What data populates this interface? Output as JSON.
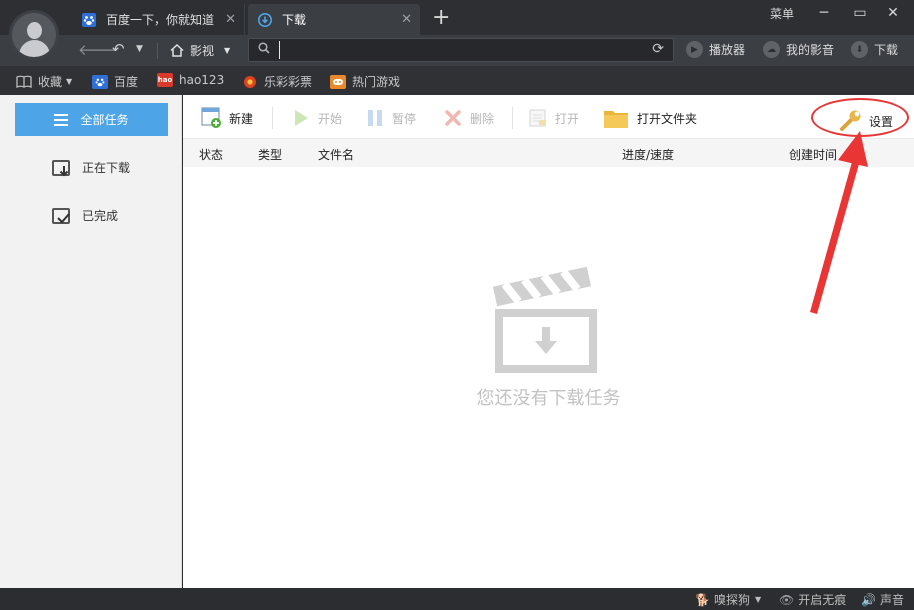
{
  "tabs": [
    {
      "title": "百度一下，你就知道",
      "icon": "baidu-paw-icon"
    },
    {
      "title": "下载",
      "icon": "download-icon"
    }
  ],
  "window": {
    "menu_label": "菜单"
  },
  "nav": {
    "home_label": "影视",
    "url_value": "",
    "right_tools": [
      "播放器",
      "我的影音",
      "下载"
    ]
  },
  "bookmarks": [
    "收藏",
    "百度",
    "hao123",
    "乐彩彩票",
    "热门游戏"
  ],
  "sidebar": {
    "items": [
      "全部任务",
      "正在下载",
      "已完成"
    ]
  },
  "toolbar": {
    "new_label": "新建",
    "start_label": "开始",
    "pause_label": "暂停",
    "delete_label": "删除",
    "open_label": "打开",
    "open_folder_label": "打开文件夹",
    "settings_label": "设置"
  },
  "table": {
    "columns": [
      "状态",
      "类型",
      "文件名",
      "进度/速度",
      "创建时间"
    ]
  },
  "empty_message": "您还没有下载任务",
  "status_bar": [
    "嗅探狗",
    "开启无痕",
    "声音"
  ],
  "colors": {
    "accent": "#4da5e8",
    "annotation": "#ea3535"
  }
}
